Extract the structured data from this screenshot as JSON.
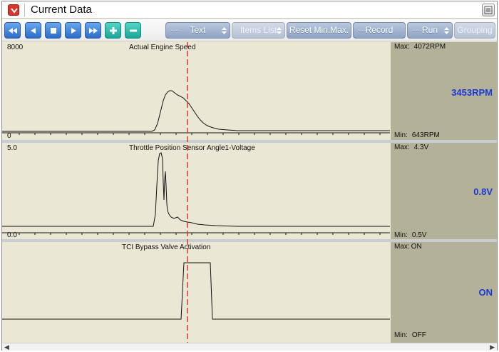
{
  "window": {
    "title": "Current Data"
  },
  "toolbar": {
    "nav_buttons": [
      "rewind-icon",
      "step-back-icon",
      "stop-icon",
      "play-icon",
      "fast-forward-icon",
      "plus-icon",
      "minus-icon"
    ],
    "text_button": "Text",
    "items_list_button": "Items List",
    "reset_button": "Reset Min.Max.",
    "record_button": "Record",
    "run_button": "Run",
    "grouping_button": "Grouping"
  },
  "panels": [
    {
      "title": "Actual Engine Speed",
      "scale_max": "8000",
      "scale_min": "0",
      "max_label": "Max:",
      "max_value": "4072RPM",
      "current_value": "3453RPM",
      "min_label": "Min:",
      "min_value": "643RPM"
    },
    {
      "title": "Throttle Position Sensor Angle1-Voltage",
      "scale_max": "5.0",
      "scale_min": "0.0",
      "max_label": "Max:",
      "max_value": "4.3V",
      "current_value": "0.8V",
      "min_label": "Min:",
      "min_value": "0.5V"
    },
    {
      "title": "TCI Bypass Valve Activation",
      "max_label": "Max:",
      "max_value": "ON",
      "current_value": "ON",
      "min_label": "Min:",
      "min_value": "OFF"
    }
  ],
  "colors": {
    "plot_bg": "#eae7d5",
    "readout_bg": "#b3b197",
    "value_text": "#1a39d6",
    "cursor_line": "#d43a2f",
    "nav_button": "#3a7bd5",
    "nav_button_teal": "#21b3a3"
  }
}
